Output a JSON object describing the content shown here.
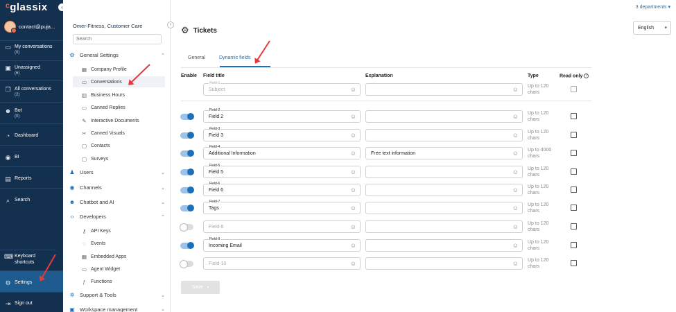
{
  "app": {
    "logo": "glassix"
  },
  "header": {
    "departments": "3 departments ▾",
    "page_title": "Tickets",
    "language": "English"
  },
  "user": {
    "name": "contact@puja..."
  },
  "nav": {
    "items": [
      {
        "label": "My conversations",
        "count": "(0)",
        "icon": "chat-icon"
      },
      {
        "label": "Unassigned",
        "count": "(6)",
        "icon": "inbox-icon"
      },
      {
        "label": "All conversations",
        "count": "(2)",
        "icon": "chats-icon"
      },
      {
        "label": "Bot",
        "count": "(0)",
        "icon": "bot-icon"
      },
      {
        "label": "Dashboard",
        "count": "",
        "icon": "dashboard-icon"
      },
      {
        "label": "BI",
        "count": "",
        "icon": "bi-icon"
      },
      {
        "label": "Reports",
        "count": "",
        "icon": "reports-icon"
      },
      {
        "label": "Search",
        "count": "",
        "icon": "search-icon"
      },
      {
        "label": "Keyboard shortcuts",
        "count": "",
        "icon": "keyboard-icon"
      },
      {
        "label": "Settings",
        "count": "",
        "icon": "gear-icon"
      },
      {
        "label": "Sign out",
        "count": "",
        "icon": "signout-icon"
      }
    ]
  },
  "sidebar": {
    "title": "Omer-Fitness, Customer Care",
    "search_placeholder": "Search",
    "general_settings": "General Settings",
    "general_items": [
      "Company Profile",
      "Conversations",
      "Business Hours",
      "Canned Replies",
      "Interactive Documents",
      "Canned Visuals",
      "Contacts",
      "Surveys"
    ],
    "groups": [
      "Users",
      "Channels",
      "Chatbot and AI",
      "Developers"
    ],
    "developer_items": [
      "API Keys",
      "Events",
      "Embedded Apps",
      "Agent Widget",
      "Functions"
    ],
    "support": "Support & Tools",
    "workspace": "Workspace management"
  },
  "tabs": [
    "General",
    "Dynamic fields"
  ],
  "columns": {
    "enable": "Enable",
    "field_title": "Field title",
    "explanation": "Explanation",
    "type": "Type",
    "read_only": "Read only"
  },
  "rows": [
    {
      "tag": "Field-1",
      "value": "Subject",
      "placeholder": true,
      "explanation": "",
      "type": "Up to 120 chars",
      "enabled": null
    },
    {
      "tag": "Field-2",
      "value": "Field 2",
      "placeholder": false,
      "explanation": "",
      "type": "Up to 120 chars",
      "enabled": true
    },
    {
      "tag": "Field-3",
      "value": "Field 3",
      "placeholder": false,
      "explanation": "",
      "type": "Up to 120 chars",
      "enabled": true
    },
    {
      "tag": "Field-4",
      "value": "Additional Information",
      "placeholder": false,
      "explanation": "Free text information",
      "type": "Up to 4000 chars",
      "enabled": true
    },
    {
      "tag": "Field-5",
      "value": "Field 5",
      "placeholder": false,
      "explanation": "",
      "type": "Up to 120 chars",
      "enabled": true
    },
    {
      "tag": "Field-6",
      "value": "Field 6",
      "placeholder": false,
      "explanation": "",
      "type": "Up to 120 chars",
      "enabled": true
    },
    {
      "tag": "Field-7",
      "value": "Tags",
      "placeholder": false,
      "explanation": "",
      "type": "Up to 120 chars",
      "enabled": true
    },
    {
      "tag": "",
      "value": "Field-8",
      "placeholder": true,
      "explanation": "",
      "type": "Up to 120 chars",
      "enabled": false
    },
    {
      "tag": "Field-9",
      "value": "Incoming Email",
      "placeholder": false,
      "explanation": "",
      "type": "Up to 120 chars",
      "enabled": true
    },
    {
      "tag": "",
      "value": "Field-10",
      "placeholder": true,
      "explanation": "",
      "type": "Up to 120 chars",
      "enabled": false
    }
  ],
  "save_label": "Save",
  "colors": {
    "nav_bg": "#13304f",
    "accent": "#1d6fb8",
    "annotation_arrow": "#e8383d"
  }
}
